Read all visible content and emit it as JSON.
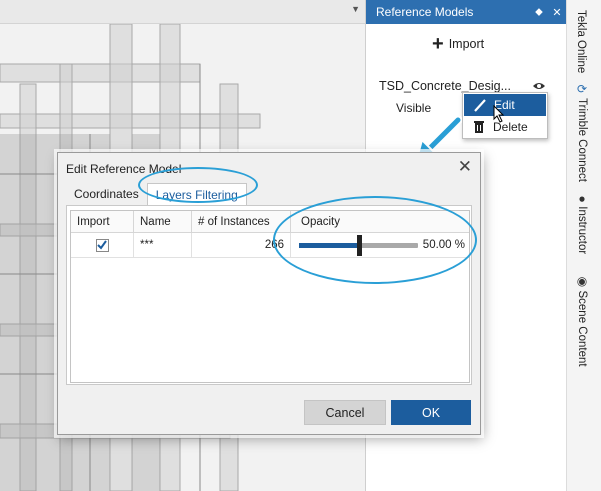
{
  "reference_panel": {
    "title": "Reference Models",
    "pin_glyph": "⬥",
    "close_glyph": "✕",
    "import_label": "Import",
    "model_name": "TSD_Concrete_Desig...",
    "visible_label": "Visible"
  },
  "context_menu": {
    "items": [
      {
        "label": "Edit",
        "icon": "pencil-icon"
      },
      {
        "label": "Delete",
        "icon": "trash-icon"
      }
    ]
  },
  "side_tabs": [
    {
      "label": "Tekla Online",
      "icon": ""
    },
    {
      "label": "Trimble Connect",
      "icon": "⟳"
    },
    {
      "label": "Instructor",
      "icon": "●"
    },
    {
      "label": "Scene Content",
      "icon": "◉"
    }
  ],
  "dialog": {
    "title": "Edit Reference Model",
    "close_glyph": "✕",
    "tabs": [
      {
        "label": "Coordinates",
        "selected": false
      },
      {
        "label": "Layers Filtering",
        "selected": true
      }
    ],
    "table": {
      "headers": [
        "Import",
        "Name",
        "# of Instances",
        "Opacity"
      ],
      "rows": [
        {
          "import": true,
          "name": "***",
          "instances": "266",
          "opacity": 0.5,
          "opacity_label": "50.00 %"
        }
      ]
    },
    "cancel_label": "Cancel",
    "ok_label": "OK"
  },
  "colors": {
    "accent": "#1c5d9e",
    "header_blue": "#2d6fb0",
    "highlight": "#2a9fd6"
  }
}
